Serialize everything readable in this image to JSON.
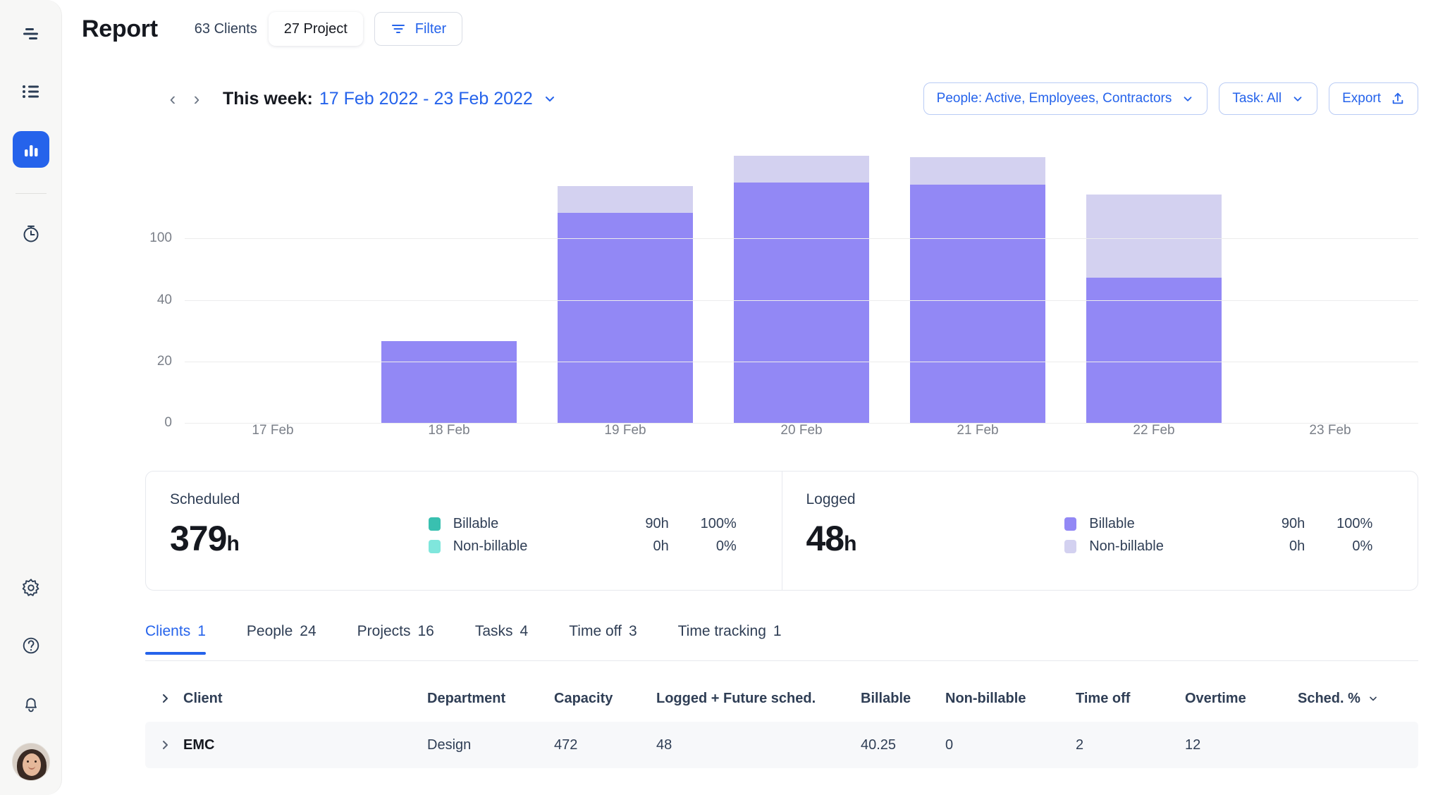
{
  "sidebar": {
    "items": [
      {
        "name": "schedule-icon",
        "label": "Schedule",
        "active": false
      },
      {
        "name": "list-icon",
        "label": "Projects list",
        "active": false
      },
      {
        "name": "chart-icon",
        "label": "Reports",
        "active": true
      },
      {
        "name": "timer-icon",
        "label": "Time tracker",
        "active": false
      }
    ],
    "bottom": [
      {
        "name": "gear-icon",
        "label": "Settings"
      },
      {
        "name": "help-icon",
        "label": "Help"
      },
      {
        "name": "bell-icon",
        "label": "Notifications"
      }
    ],
    "avatar_label": "User avatar"
  },
  "header": {
    "title": "Report",
    "clients_count": "63 Clients",
    "projects_chip": "27 Project",
    "filter_label": "Filter"
  },
  "datebar": {
    "prev_label": "‹",
    "next_label": "›",
    "this_week_label": "This week:",
    "range": "17 Feb 2022 - 23 Feb 2022",
    "people_filter": "People: Active, Employees, Contractors",
    "task_filter": "Task: All",
    "export_label": "Export"
  },
  "chart_data": {
    "type": "bar",
    "title": "",
    "xlabel": "",
    "ylabel": "",
    "categories": [
      "17 Feb",
      "18 Feb",
      "19 Feb",
      "20 Feb",
      "21 Feb",
      "22 Feb",
      "23 Feb"
    ],
    "ytick_labels": [
      "100",
      "40",
      "20",
      "0"
    ],
    "ytick_positions_pct": [
      34.5,
      56.6,
      78.3,
      100.0
    ],
    "grid": true,
    "legend_position": "none",
    "series": [
      {
        "name": "Logged",
        "color": "#9288f5",
        "values": [
          0,
          23,
          95,
          118,
          115,
          53,
          0
        ]
      },
      {
        "name": "Scheduled (remaining)",
        "color": "#d3d1f0",
        "values": [
          0,
          0,
          14,
          9,
          9,
          29,
          0
        ]
      }
    ],
    "bar_pixel_geometry": [
      {
        "category": "17 Feb",
        "solid_top_pct": 100.0,
        "light_top_pct": 100.0
      },
      {
        "category": "18 Feb",
        "solid_top_pct": 71.0,
        "light_top_pct": 71.0
      },
      {
        "category": "19 Feb",
        "solid_top_pct": 25.6,
        "light_top_pct": 16.0
      },
      {
        "category": "20 Feb",
        "solid_top_pct": 14.8,
        "light_top_pct": 5.2
      },
      {
        "category": "21 Feb",
        "solid_top_pct": 15.6,
        "light_top_pct": 5.7
      },
      {
        "category": "22 Feb",
        "solid_top_pct": 48.5,
        "light_top_pct": 19.0
      },
      {
        "category": "23 Feb",
        "solid_top_pct": 100.0,
        "light_top_pct": 100.0
      }
    ]
  },
  "cards": [
    {
      "title": "Scheduled",
      "value": "379",
      "unit": "h",
      "legend": [
        {
          "name": "Billable",
          "hours": "90h",
          "pct": "100%",
          "color": "#39c0b0"
        },
        {
          "name": "Non-billable",
          "hours": "0h",
          "pct": "0%",
          "color": "#7fe6dc"
        }
      ]
    },
    {
      "title": "Logged",
      "value": "48",
      "unit": "h",
      "legend": [
        {
          "name": "Billable",
          "hours": "90h",
          "pct": "100%",
          "color": "#9288f5"
        },
        {
          "name": "Non-billable",
          "hours": "0h",
          "pct": "0%",
          "color": "#d3d1f0"
        }
      ]
    }
  ],
  "tabs": [
    {
      "label": "Clients",
      "count": "1",
      "active": true
    },
    {
      "label": "People",
      "count": "24",
      "active": false
    },
    {
      "label": "Projects",
      "count": "16",
      "active": false
    },
    {
      "label": "Tasks",
      "count": "4",
      "active": false
    },
    {
      "label": "Time off",
      "count": "3",
      "active": false
    },
    {
      "label": "Time tracking",
      "count": "1",
      "active": false
    }
  ],
  "table": {
    "columns": {
      "client": "Client",
      "department": "Department",
      "capacity": "Capacity",
      "logged_future": "Logged + Future sched.",
      "billable": "Billable",
      "non_billable": "Non-billable",
      "time_off": "Time off",
      "overtime": "Overtime",
      "sched_pct": "Sched. %"
    },
    "rows": [
      {
        "client": "EMC",
        "department": "Design",
        "capacity": "472",
        "logged_future": "48",
        "billable": "40.25",
        "non_billable": "0",
        "time_off": "2",
        "overtime": "12",
        "sched_pct": ""
      }
    ]
  },
  "colors": {
    "accent_blue": "#2563eb",
    "bar_solid": "#9288f5",
    "bar_light": "#d3d1f0",
    "teal": "#39c0b0",
    "teal_light": "#7fe6dc"
  }
}
